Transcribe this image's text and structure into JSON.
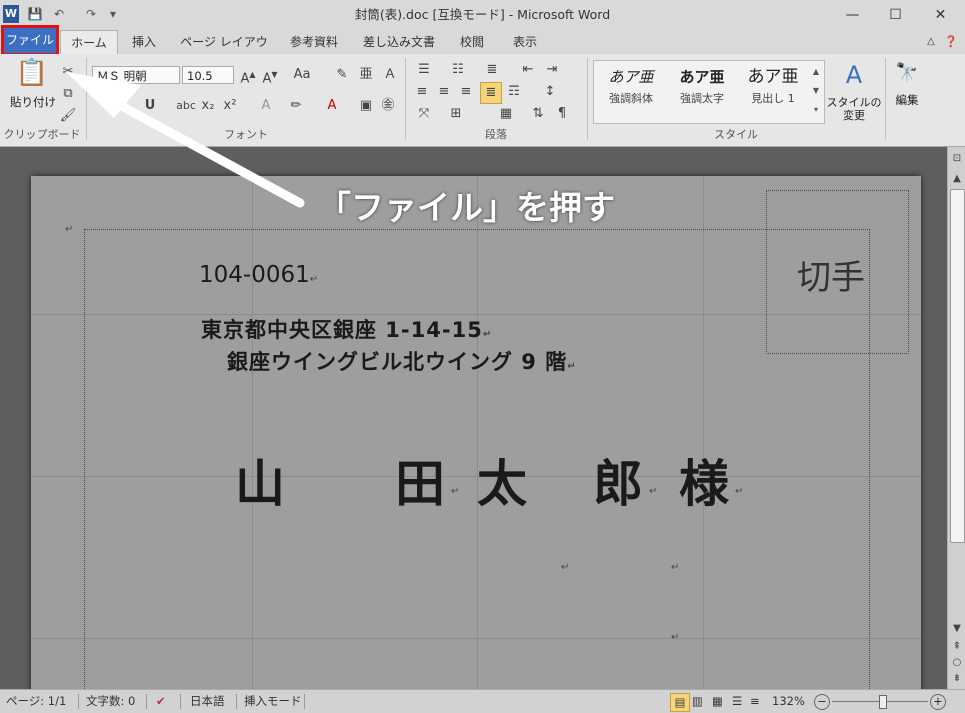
{
  "window": {
    "title": "封筒(表).doc [互換モード] - Microsoft Word",
    "logo_letter": "W",
    "minimize": "—",
    "maximize": "☐",
    "close": "✕"
  },
  "quick_access": [
    "💾",
    "↶",
    "↷",
    "▾"
  ],
  "tabs": {
    "file": "ファイル",
    "items": [
      "ホーム",
      "挿入",
      "ページ レイアウト",
      "参考資料",
      "差し込み文書",
      "校閲",
      "表示"
    ]
  },
  "ribbon": {
    "clipboard": {
      "paste_label": "貼り付け",
      "group_label": "クリップボード"
    },
    "font": {
      "font_name": "ＭＳ 明朝",
      "font_size": "10.5",
      "group_label": "フォント"
    },
    "paragraph": {
      "group_label": "段落"
    },
    "styles": {
      "group_label": "スタイル",
      "items": [
        {
          "sample": "あア亜",
          "name": "強調斜体"
        },
        {
          "sample": "あア亜",
          "name": "強調太字"
        },
        {
          "sample": "あア亜",
          "name": "見出し 1"
        }
      ],
      "change_label": "スタイルの変更"
    },
    "editing": {
      "label": "編集"
    }
  },
  "document": {
    "stamp": "切手",
    "postal_code": "104-0061",
    "address_line1": "東京都中央区銀座 1-14-15",
    "address_line2": "銀座ウイングビル北ウイング 9 階",
    "name_chars": [
      "山",
      "田",
      "太",
      "郎",
      "様"
    ],
    "para_mark": "↵"
  },
  "status": {
    "page": "ページ: 1/1",
    "words": "文字数: 0",
    "language": "日本語",
    "mode": "挿入モード",
    "zoom": "132%",
    "zoom_out": "−",
    "zoom_in": "+"
  },
  "annotation": {
    "callout": "「ファイル」を押す",
    "highlight_color": "#e01414"
  }
}
